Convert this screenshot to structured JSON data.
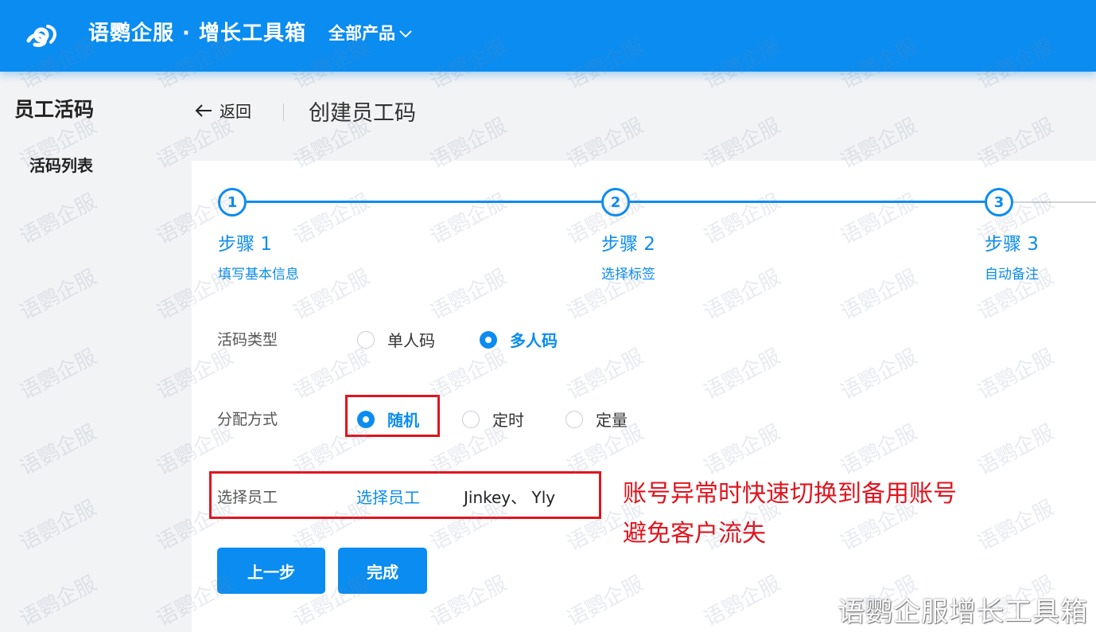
{
  "header": {
    "brand": "语鹦企服 · 增长工具箱",
    "products_label": "全部产品"
  },
  "sidebar": {
    "title": "员工活码",
    "items": [
      {
        "label": "活码列表"
      }
    ]
  },
  "page": {
    "back_label": "返回",
    "title": "创建员工码"
  },
  "steps": [
    {
      "number": "1",
      "title": "步骤 1",
      "desc": "填写基本信息"
    },
    {
      "number": "2",
      "title": "步骤 2",
      "desc": "选择标签"
    },
    {
      "number": "3",
      "title": "步骤 3",
      "desc": "自动备注"
    }
  ],
  "form": {
    "code_type": {
      "label": "活码类型",
      "options": [
        {
          "label": "单人码",
          "checked": false
        },
        {
          "label": "多人码",
          "checked": true
        }
      ]
    },
    "assign": {
      "label": "分配方式",
      "options": [
        {
          "label": "随机",
          "checked": true
        },
        {
          "label": "定时",
          "checked": false
        },
        {
          "label": "定量",
          "checked": false
        }
      ]
    },
    "staff": {
      "label": "选择员工",
      "link_label": "选择员工",
      "selected": "Jinkey、 Yly"
    }
  },
  "buttons": {
    "prev": "上一步",
    "finish": "完成"
  },
  "annotation": {
    "line1": "账号异常时快速切换到备用账号",
    "line2": "避免客户流失"
  },
  "watermark": "语鹦企服",
  "footer_brand": "语鹦企服增长工具箱",
  "colors": {
    "primary": "#0a8cf0",
    "highlight": "#e0141e"
  }
}
